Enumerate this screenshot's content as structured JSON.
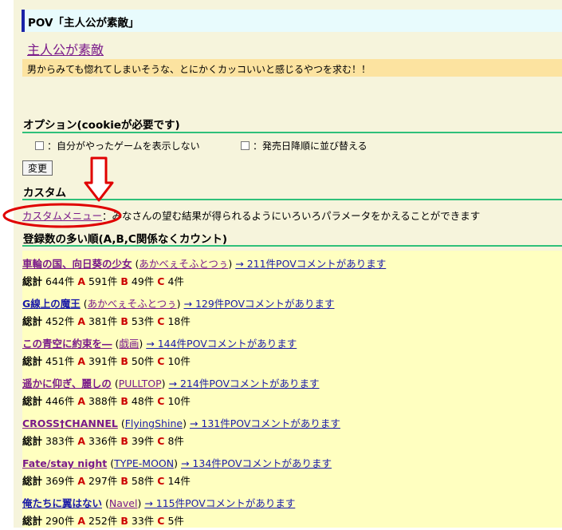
{
  "header": {
    "title": "POV「主人公が素敵」"
  },
  "page_title": "主人公が素敵",
  "description": "男からみても惚れてしまいそうな、とにかくカッコいいと感じるやつを求む！！",
  "options": {
    "heading": "オプション(cookieが必要です)",
    "opt1": "：自分がやったゲームを表示しない",
    "opt2": "：発売日降順に並び替える",
    "change_button": "変更"
  },
  "custom": {
    "heading": "カスタム",
    "link": "カスタムメニュー",
    "text": "：みなさんの望む結果が得られるようにいろいろパラメータをかえることができます"
  },
  "ranking": {
    "heading": "登録数の多い順(A,B,C関係なくカウント)",
    "labels": {
      "total": "総計",
      "a": "A",
      "b": "B",
      "c": "C"
    },
    "entries": [
      {
        "title": "車輪の国、向日葵の少女",
        "brand": "あかべぇそふとつぅ",
        "comments": "→ 211件POVコメントがあります",
        "total": "644件",
        "a": "591件",
        "b": "49件",
        "c": "4件"
      },
      {
        "title": "G線上の魔王",
        "brand": "あかべぇそふとつぅ",
        "comments": "→ 129件POVコメントがあります",
        "total": "452件",
        "a": "381件",
        "b": "53件",
        "c": "18件"
      },
      {
        "title": "この青空に約束を―",
        "brand": "戯画",
        "comments": "→ 144件POVコメントがあります",
        "total": "451件",
        "a": "391件",
        "b": "50件",
        "c": "10件"
      },
      {
        "title": "遥かに仰ぎ、麗しの",
        "brand": "PULLTOP",
        "comments": "→ 214件POVコメントがあります",
        "total": "446件",
        "a": "388件",
        "b": "48件",
        "c": "10件"
      },
      {
        "title": "CROSS†CHANNEL",
        "brand": "FlyingShine",
        "comments": "→ 131件POVコメントがあります",
        "total": "383件",
        "a": "336件",
        "b": "39件",
        "c": "8件"
      },
      {
        "title": "Fate/stay night",
        "brand": "TYPE-MOON",
        "comments": "→ 134件POVコメントがあります",
        "total": "369件",
        "a": "297件",
        "b": "58件",
        "c": "14件"
      },
      {
        "title": "俺たちに翼はない",
        "brand": "Navel",
        "comments": "→ 115件POVコメントがあります",
        "total": "290件",
        "a": "252件",
        "b": "33件",
        "c": "5件"
      }
    ]
  }
}
